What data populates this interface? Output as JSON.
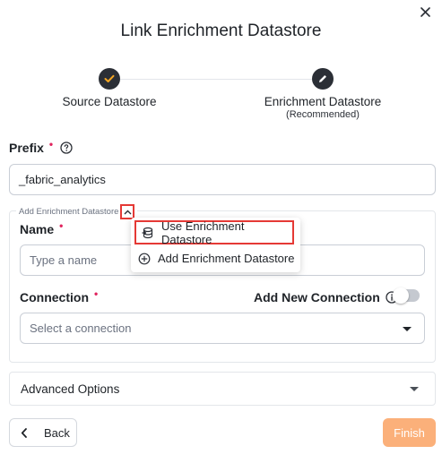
{
  "dialog": {
    "title": "Link Enrichment Datastore",
    "close_icon": "close-icon"
  },
  "stepper": {
    "step1": {
      "label": "Source Datastore",
      "icon": "check-icon",
      "status": "completed"
    },
    "step2": {
      "label": "Enrichment Datastore",
      "sublabel": "(Recommended)",
      "icon": "pencil-icon",
      "status": "active"
    }
  },
  "prefix": {
    "label": "Prefix",
    "required_mark": "•",
    "help_icon": "help-circle-icon",
    "value": "_fabric_analytics"
  },
  "enrichment_section": {
    "legend": "Add Enrichment Datastore",
    "toggle_icon": "chevron-up-icon",
    "name_label": "Name",
    "name_required": "•",
    "name_placeholder": "Type a name",
    "connection_label": "Connection",
    "connection_required": "•",
    "add_new_connection_label": "Add New Connection",
    "add_new_connection_info_icon": "info-icon",
    "add_new_connection_enabled": false,
    "connection_placeholder": "Select a connection"
  },
  "dropdown_menu": {
    "items": [
      {
        "label": "Use Enrichment Datastore",
        "icon": "database-link-icon",
        "highlighted": true
      },
      {
        "label": "Add Enrichment Datastore",
        "icon": "plus-circle-icon",
        "highlighted": false
      }
    ]
  },
  "advanced": {
    "label": "Advanced Options"
  },
  "footer": {
    "back_label": "Back",
    "finish_label": "Finish"
  },
  "colors": {
    "primary_dark": "#2b2f36",
    "accent_orange": "#f5a623",
    "finish_button": "#fbb07a",
    "required": "#e0245e",
    "highlight_border": "#e53935"
  }
}
